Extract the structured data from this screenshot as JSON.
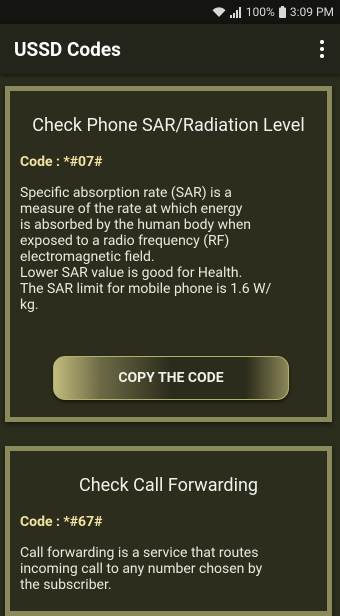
{
  "status_bar": {
    "wifi_icon": "wifi-icon",
    "signal_icon": "signal-icon",
    "battery_text": "100%",
    "battery_icon": "battery-icon",
    "time": "3:09 PM"
  },
  "app_bar": {
    "title": "USSD Codes",
    "menu_icon": "overflow-menu-icon"
  },
  "cards": [
    {
      "title": "Check Phone SAR/Radiation Level",
      "code": "Code : *#07#",
      "description": [
        "Specific absorption rate (SAR) is a",
        "measure of the rate at which energy",
        "is absorbed by the human body when",
        "exposed to a radio frequency (RF)",
        "electromagnetic field.",
        "Lower SAR value is good for Health.",
        "The SAR limit for mobile phone is 1.6 W/",
        "kg."
      ],
      "button_label": "COPY THE CODE"
    },
    {
      "title": "Check Call Forwarding",
      "code": "Code : *#67#",
      "description": [
        "Call forwarding is a service that routes",
        "incoming call to any number chosen by",
        "the subscriber."
      ]
    }
  ],
  "colors": {
    "background": "#2b2e1d",
    "card_border": "#8b8a5c",
    "card_fill": "#2c2d1c",
    "code_text": "#f2e3a2"
  }
}
